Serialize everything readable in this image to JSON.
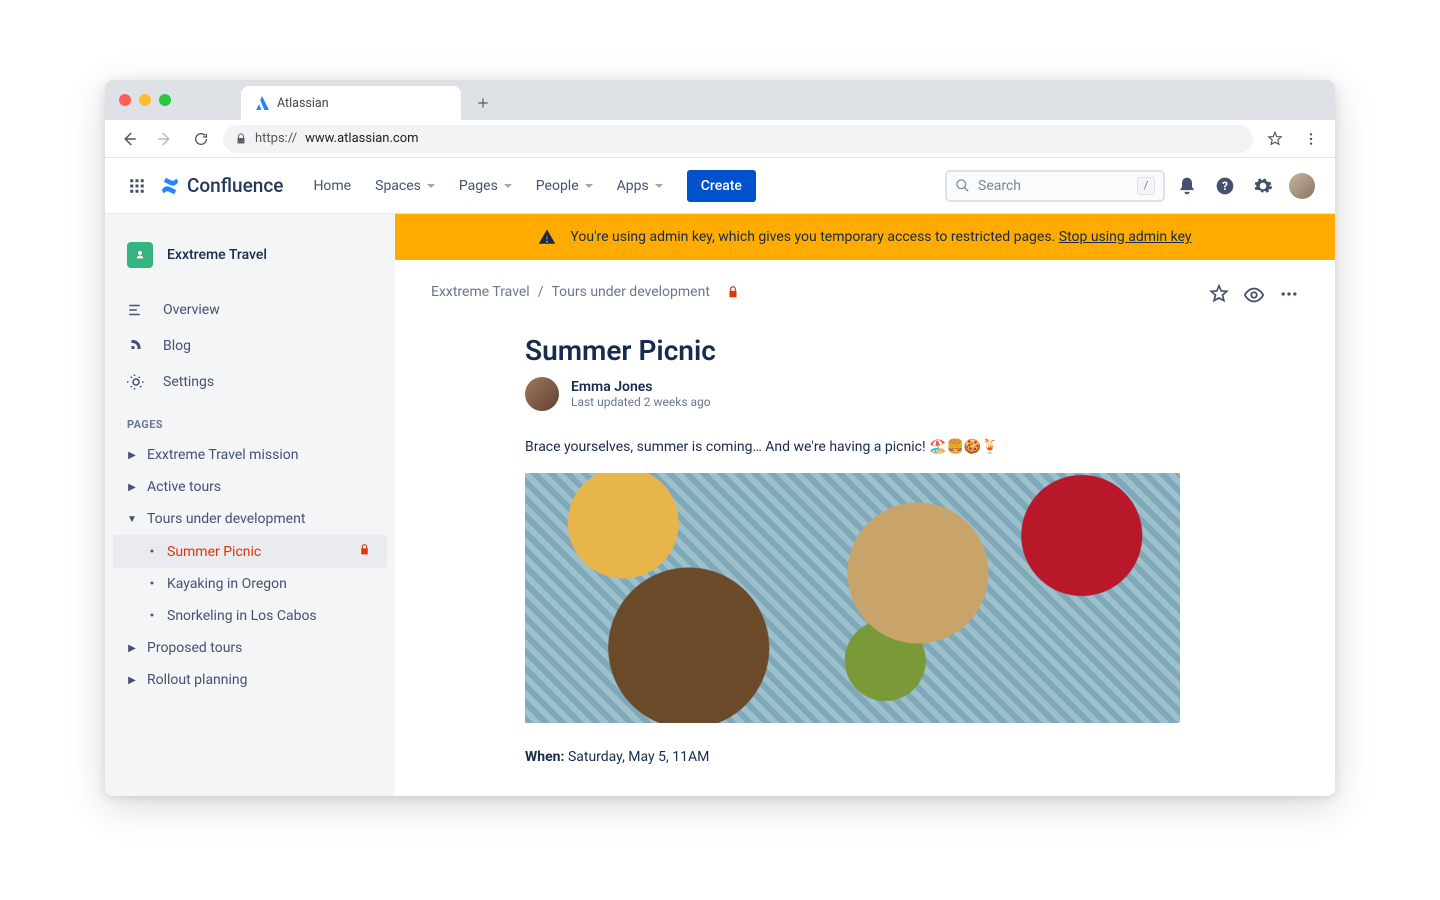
{
  "browser": {
    "tab_title": "Atlassian",
    "url_scheme": "https://",
    "url_host": "www.atlassian.com"
  },
  "nav": {
    "product": "Confluence",
    "items": [
      "Home",
      "Spaces",
      "Pages",
      "People",
      "Apps"
    ],
    "create": "Create",
    "search_placeholder": "Search",
    "search_hint": "/"
  },
  "sidebar": {
    "space": "Exxtreme Travel",
    "items": [
      {
        "icon": "overview",
        "label": "Overview"
      },
      {
        "icon": "blog",
        "label": "Blog"
      },
      {
        "icon": "settings",
        "label": "Settings"
      }
    ],
    "section": "PAGES",
    "tree": [
      {
        "depth": 1,
        "expand": "right",
        "label": "Exxtreme Travel mission"
      },
      {
        "depth": 1,
        "expand": "right",
        "label": "Active tours"
      },
      {
        "depth": 1,
        "expand": "down",
        "label": "Tours under development"
      },
      {
        "depth": 2,
        "expand": "bullet",
        "label": "Summer Picnic",
        "selected": true,
        "locked": true
      },
      {
        "depth": 2,
        "expand": "bullet",
        "label": "Kayaking in Oregon"
      },
      {
        "depth": 2,
        "expand": "bullet",
        "label": "Snorkeling in Los Cabos"
      },
      {
        "depth": 1,
        "expand": "right",
        "label": "Proposed tours"
      },
      {
        "depth": 1,
        "expand": "right",
        "label": "Rollout planning"
      }
    ]
  },
  "banner": {
    "text": "You're using admin key, which gives you temporary access to restricted pages.",
    "link": "Stop using admin key"
  },
  "breadcrumb": {
    "root": "Exxtreme Travel",
    "sep": "/",
    "page": "Tours under development"
  },
  "page": {
    "title": "Summer Picnic",
    "author": "Emma Jones",
    "updated": "Last updated 2 weeks ago",
    "intro": "Brace yourselves, summer is coming… And we're having a picnic! 🏖️🍔🍪🍹",
    "when_label": "When:",
    "when_value": "Saturday, May 5, 11AM"
  }
}
